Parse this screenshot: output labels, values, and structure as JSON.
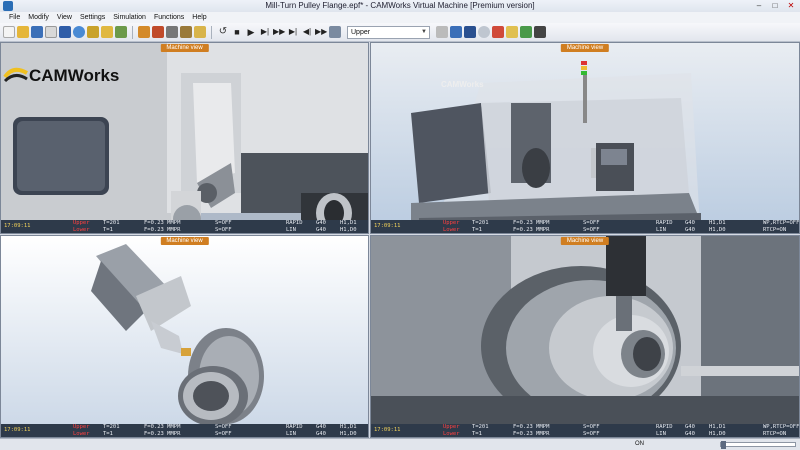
{
  "window": {
    "title": "Mill-Turn Pulley Flange.epf* - CAMWorks Virtual Machine [Premium version]",
    "minimize": "–",
    "maximize": "□",
    "close": "✕"
  },
  "menu": [
    "File",
    "Modify",
    "View",
    "Settings",
    "Simulation",
    "Functions",
    "Help"
  ],
  "toolbar": {
    "view_select": "Upper",
    "icons_left": [
      "new-doc-icon",
      "open-folder-icon",
      "save-icon",
      "document-icon",
      "window-icon",
      "zoom-icon",
      "ruler-icon",
      "tool-icon",
      "gear-icon",
      "layers-icon",
      "pencil-icon",
      "wrench-icon",
      "settings-icon",
      "clipboard-icon"
    ],
    "playback": [
      "rewind-icon",
      "stop-icon",
      "play-icon",
      "step-icon",
      "fast-forward-icon",
      "end-icon",
      "step-back-icon",
      "next-op-icon",
      "list-icon"
    ],
    "icons_right": [
      "lock-icon",
      "person-icon",
      "robot-icon",
      "sphere-icon",
      "axis-icon",
      "cube-icon",
      "arrows-icon",
      "box-icon"
    ]
  },
  "viewports": [
    {
      "title": "Machine view",
      "time": "17:09:11",
      "ch1": "Upper",
      "ch2": "Lower",
      "t1": "T=201",
      "t2": "T=1",
      "f1": "F=0.23 MMPM",
      "f2": "F=0.23 MMPR",
      "s1": "S=OFF",
      "s2": "S=OFF",
      "m1": "RAPID",
      "m2": "LIN",
      "g1": "G40",
      "g2": "G40",
      "h1": "H1,D1",
      "h2": "H1,D0",
      "w1": "",
      "w2": ""
    },
    {
      "title": "Machine view",
      "time": "17:09:11",
      "ch1": "Upper",
      "ch2": "Lower",
      "t1": "T=201",
      "t2": "T=1",
      "f1": "F=0.23 MMPM",
      "f2": "F=0.23 MMPR",
      "s1": "S=OFF",
      "s2": "S=OFF",
      "m1": "RAPID",
      "m2": "LIN",
      "g1": "G40",
      "g2": "G40",
      "h1": "H1,D1",
      "h2": "H1,D0",
      "w1": "WP,RTCP=OFF",
      "w2": "RTCP=ON"
    },
    {
      "title": "Machine view",
      "time": "17:09:11",
      "ch1": "Upper",
      "ch2": "Lower",
      "t1": "T=201",
      "t2": "T=1",
      "f1": "F=0.23 MMPM",
      "f2": "F=0.23 MMPR",
      "s1": "S=OFF",
      "s2": "S=OFF",
      "m1": "RAPID",
      "m2": "LIN",
      "g1": "G40",
      "g2": "G40",
      "h1": "H1,D1",
      "h2": "H1,D0",
      "w1": "",
      "w2": ""
    },
    {
      "title": "Machine view",
      "time": "17:09:11",
      "ch1": "Upper",
      "ch2": "Lower",
      "t1": "T=201",
      "t2": "T=1",
      "f1": "F=0.23 MMPM",
      "f2": "F=0.23 MMPR",
      "s1": "S=OFF",
      "s2": "S=OFF",
      "m1": "RAPID",
      "m2": "LIN",
      "g1": "G40",
      "g2": "G40",
      "h1": "H1,D1",
      "h2": "H1,D0",
      "w1": "WP,RTCP=OFF",
      "w2": "RTCP=ON"
    }
  ],
  "logo": "CAMWorks",
  "machine_brand": "CAMWorks",
  "statusbar": {
    "state": "ON",
    "speed_fraction": 0.0
  }
}
